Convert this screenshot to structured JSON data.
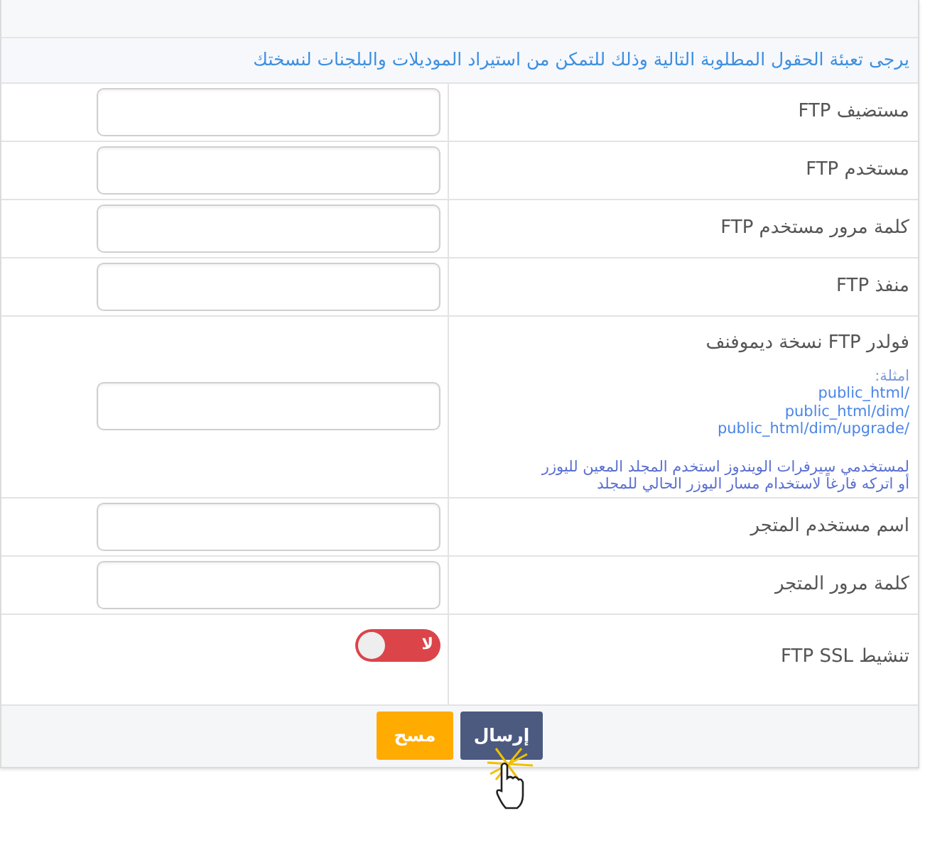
{
  "intro": "يرجى تعبئة الحقول المطلوبة التالية وذلك للتمكن من استيراد الموديلات والبلجنات لنسختك",
  "fields": [
    {
      "kind": "text",
      "label": "مستضيف FTP"
    },
    {
      "kind": "text",
      "label": "مستخدم FTP"
    },
    {
      "kind": "text",
      "label": "كلمة مرور مستخدم FTP"
    },
    {
      "kind": "text",
      "label": "منفذ FTP"
    },
    {
      "kind": "text",
      "label": "فولدر FTP نسخة ديموفنف",
      "help": {
        "examples_label": "امثلة:",
        "examples": [
          "/public_html",
          "/public_html/dim",
          "/public_html/dim/upgrade"
        ],
        "notes": [
          "لمستخدمي سيرفرات الويندوز استخدم المجلد المعين لليوزر",
          "أو اتركه فارغاً لاستخدام مسار اليوزر الحالي للمجلد"
        ]
      }
    },
    {
      "kind": "text",
      "label": "اسم مستخدم المتجر"
    },
    {
      "kind": "text",
      "label": "كلمة مرور المتجر"
    },
    {
      "kind": "toggle",
      "label": "تنشيط FTP SSL",
      "on": false,
      "state_text": "لا"
    }
  ],
  "buttons": [
    {
      "kind": "primary",
      "label": "إرسال"
    },
    {
      "kind": "warning",
      "label": "مسح"
    }
  ]
}
